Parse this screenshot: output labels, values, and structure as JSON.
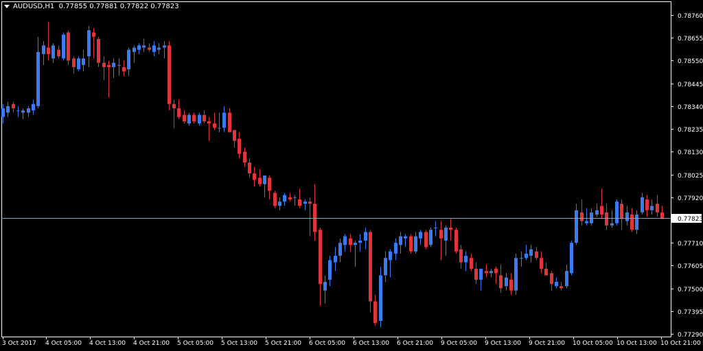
{
  "header": {
    "symbol": "AUDUSD,H1",
    "ohlc": "0.77855 0.77881 0.77822 0.77823"
  },
  "colors": {
    "background": "#000000",
    "axis": "#ffffff",
    "bull": "#3b7bf0",
    "bear": "#e0353a",
    "price_line": "#8fa0c0",
    "price_label_bg": "#ffffff",
    "price_label_text": "#000000"
  },
  "chart_data": {
    "type": "candlestick",
    "title": "AUDUSD,H1",
    "ylim": [
      0.7729,
      0.7876
    ],
    "y_ticks": [
      "0.78760",
      "0.78655",
      "0.78550",
      "0.78445",
      "0.78340",
      "0.78235",
      "0.78130",
      "0.78025",
      "0.77920",
      "0.77823",
      "0.77710",
      "0.77605",
      "0.77500",
      "0.77395",
      "0.77290"
    ],
    "x_ticks": [
      "3 Oct 2017",
      "4 Oct 05:00",
      "4 Oct 13:00",
      "4 Oct 21:00",
      "5 Oct 05:00",
      "5 Oct 13:00",
      "5 Oct 21:00",
      "6 Oct 05:00",
      "6 Oct 13:00",
      "6 Oct 21:00",
      "9 Oct 05:00",
      "9 Oct 13:00",
      "9 Oct 21:00",
      "10 Oct 05:00",
      "10 Oct 13:00",
      "10 Oct 21:00"
    ],
    "current_price": "0.77823",
    "candles": [
      {
        "o": 0.7829,
        "h": 0.7835,
        "l": 0.7826,
        "c": 0.7833
      },
      {
        "o": 0.7831,
        "h": 0.7836,
        "l": 0.7829,
        "c": 0.7834
      },
      {
        "o": 0.7835,
        "h": 0.7836,
        "l": 0.7831,
        "c": 0.7833
      },
      {
        "o": 0.7832,
        "h": 0.7834,
        "l": 0.7829,
        "c": 0.7832
      },
      {
        "o": 0.7831,
        "h": 0.7833,
        "l": 0.7828,
        "c": 0.7832
      },
      {
        "o": 0.7831,
        "h": 0.7834,
        "l": 0.7829,
        "c": 0.7833
      },
      {
        "o": 0.7832,
        "h": 0.7837,
        "l": 0.783,
        "c": 0.7835
      },
      {
        "o": 0.7834,
        "h": 0.7866,
        "l": 0.7833,
        "c": 0.7859
      },
      {
        "o": 0.7858,
        "h": 0.7864,
        "l": 0.7853,
        "c": 0.7862
      },
      {
        "o": 0.7861,
        "h": 0.7873,
        "l": 0.7855,
        "c": 0.7858
      },
      {
        "o": 0.7856,
        "h": 0.7863,
        "l": 0.7854,
        "c": 0.7862
      },
      {
        "o": 0.786,
        "h": 0.7862,
        "l": 0.7856,
        "c": 0.7857
      },
      {
        "o": 0.7856,
        "h": 0.7868,
        "l": 0.7855,
        "c": 0.7867
      },
      {
        "o": 0.7868,
        "h": 0.7869,
        "l": 0.7853,
        "c": 0.7855
      },
      {
        "o": 0.7856,
        "h": 0.7857,
        "l": 0.7849,
        "c": 0.7852
      },
      {
        "o": 0.7851,
        "h": 0.7857,
        "l": 0.785,
        "c": 0.7856
      },
      {
        "o": 0.7853,
        "h": 0.786,
        "l": 0.785,
        "c": 0.7856
      },
      {
        "o": 0.7857,
        "h": 0.7871,
        "l": 0.7852,
        "c": 0.7869
      },
      {
        "o": 0.7868,
        "h": 0.787,
        "l": 0.7856,
        "c": 0.7866
      },
      {
        "o": 0.7865,
        "h": 0.7866,
        "l": 0.7852,
        "c": 0.7854
      },
      {
        "o": 0.7854,
        "h": 0.7857,
        "l": 0.7846,
        "c": 0.7852
      },
      {
        "o": 0.7853,
        "h": 0.7855,
        "l": 0.7838,
        "c": 0.7852
      },
      {
        "o": 0.7852,
        "h": 0.7856,
        "l": 0.7847,
        "c": 0.7854
      },
      {
        "o": 0.7853,
        "h": 0.7856,
        "l": 0.7848,
        "c": 0.7853
      },
      {
        "o": 0.7852,
        "h": 0.7855,
        "l": 0.7848,
        "c": 0.785
      },
      {
        "o": 0.7851,
        "h": 0.7861,
        "l": 0.7848,
        "c": 0.786
      },
      {
        "o": 0.7859,
        "h": 0.7862,
        "l": 0.7854,
        "c": 0.7861
      },
      {
        "o": 0.786,
        "h": 0.7863,
        "l": 0.7858,
        "c": 0.7862
      },
      {
        "o": 0.7861,
        "h": 0.7865,
        "l": 0.7859,
        "c": 0.7862
      },
      {
        "o": 0.7861,
        "h": 0.7863,
        "l": 0.7859,
        "c": 0.786
      },
      {
        "o": 0.7859,
        "h": 0.7864,
        "l": 0.7857,
        "c": 0.7862
      },
      {
        "o": 0.786,
        "h": 0.7863,
        "l": 0.7858,
        "c": 0.7861
      },
      {
        "o": 0.7861,
        "h": 0.7864,
        "l": 0.7856,
        "c": 0.7862
      },
      {
        "o": 0.7862,
        "h": 0.7864,
        "l": 0.7832,
        "c": 0.7835
      },
      {
        "o": 0.7835,
        "h": 0.7837,
        "l": 0.7824,
        "c": 0.7833
      },
      {
        "o": 0.7833,
        "h": 0.7837,
        "l": 0.7828,
        "c": 0.7829
      },
      {
        "o": 0.783,
        "h": 0.7832,
        "l": 0.7826,
        "c": 0.7827
      },
      {
        "o": 0.7826,
        "h": 0.7831,
        "l": 0.7825,
        "c": 0.783
      },
      {
        "o": 0.783,
        "h": 0.7831,
        "l": 0.7826,
        "c": 0.7827
      },
      {
        "o": 0.7826,
        "h": 0.7831,
        "l": 0.7825,
        "c": 0.783
      },
      {
        "o": 0.783,
        "h": 0.7832,
        "l": 0.7826,
        "c": 0.7827
      },
      {
        "o": 0.7827,
        "h": 0.7829,
        "l": 0.7818,
        "c": 0.7826
      },
      {
        "o": 0.7826,
        "h": 0.7831,
        "l": 0.7823,
        "c": 0.7824
      },
      {
        "o": 0.7824,
        "h": 0.7831,
        "l": 0.7822,
        "c": 0.7824
      },
      {
        "o": 0.7824,
        "h": 0.7834,
        "l": 0.7822,
        "c": 0.7831
      },
      {
        "o": 0.7831,
        "h": 0.7833,
        "l": 0.7822,
        "c": 0.7822
      },
      {
        "o": 0.7823,
        "h": 0.7823,
        "l": 0.7815,
        "c": 0.7818
      },
      {
        "o": 0.7819,
        "h": 0.7822,
        "l": 0.781,
        "c": 0.7812
      },
      {
        "o": 0.7813,
        "h": 0.7815,
        "l": 0.7806,
        "c": 0.7808
      },
      {
        "o": 0.7808,
        "h": 0.781,
        "l": 0.7801,
        "c": 0.7803
      },
      {
        "o": 0.7803,
        "h": 0.7806,
        "l": 0.7797,
        "c": 0.78
      },
      {
        "o": 0.7801,
        "h": 0.7805,
        "l": 0.7797,
        "c": 0.7798
      },
      {
        "o": 0.7798,
        "h": 0.7802,
        "l": 0.7792,
        "c": 0.7802
      },
      {
        "o": 0.7801,
        "h": 0.7802,
        "l": 0.7791,
        "c": 0.7795
      },
      {
        "o": 0.7794,
        "h": 0.7795,
        "l": 0.7787,
        "c": 0.7788
      },
      {
        "o": 0.7788,
        "h": 0.7792,
        "l": 0.7786,
        "c": 0.779
      },
      {
        "o": 0.779,
        "h": 0.7794,
        "l": 0.7788,
        "c": 0.7793
      },
      {
        "o": 0.7792,
        "h": 0.7794,
        "l": 0.779,
        "c": 0.7791
      },
      {
        "o": 0.7792,
        "h": 0.7793,
        "l": 0.7788,
        "c": 0.7792
      },
      {
        "o": 0.7791,
        "h": 0.7796,
        "l": 0.7787,
        "c": 0.7788
      },
      {
        "o": 0.7789,
        "h": 0.7791,
        "l": 0.7786,
        "c": 0.779
      },
      {
        "o": 0.779,
        "h": 0.7792,
        "l": 0.7774,
        "c": 0.7789
      },
      {
        "o": 0.7789,
        "h": 0.7798,
        "l": 0.7772,
        "c": 0.7776
      },
      {
        "o": 0.7777,
        "h": 0.7778,
        "l": 0.7742,
        "c": 0.7752
      },
      {
        "o": 0.7749,
        "h": 0.7756,
        "l": 0.7743,
        "c": 0.7753
      },
      {
        "o": 0.7754,
        "h": 0.7765,
        "l": 0.7751,
        "c": 0.7763
      },
      {
        "o": 0.7762,
        "h": 0.7769,
        "l": 0.7758,
        "c": 0.7765
      },
      {
        "o": 0.7765,
        "h": 0.7773,
        "l": 0.7762,
        "c": 0.7771
      },
      {
        "o": 0.777,
        "h": 0.7775,
        "l": 0.7767,
        "c": 0.7774
      },
      {
        "o": 0.7773,
        "h": 0.7775,
        "l": 0.7767,
        "c": 0.777
      },
      {
        "o": 0.777,
        "h": 0.7772,
        "l": 0.776,
        "c": 0.7771
      },
      {
        "o": 0.7771,
        "h": 0.7775,
        "l": 0.7767,
        "c": 0.7772
      },
      {
        "o": 0.7772,
        "h": 0.7778,
        "l": 0.7768,
        "c": 0.7776
      },
      {
        "o": 0.7776,
        "h": 0.7777,
        "l": 0.7739,
        "c": 0.7744
      },
      {
        "o": 0.7744,
        "h": 0.7747,
        "l": 0.7733,
        "c": 0.7734
      },
      {
        "o": 0.7735,
        "h": 0.776,
        "l": 0.7732,
        "c": 0.7756
      },
      {
        "o": 0.7756,
        "h": 0.7767,
        "l": 0.7753,
        "c": 0.7764
      },
      {
        "o": 0.7763,
        "h": 0.7768,
        "l": 0.7755,
        "c": 0.7767
      },
      {
        "o": 0.7766,
        "h": 0.7773,
        "l": 0.7763,
        "c": 0.7771
      },
      {
        "o": 0.777,
        "h": 0.7776,
        "l": 0.7766,
        "c": 0.7774
      },
      {
        "o": 0.7773,
        "h": 0.7775,
        "l": 0.7769,
        "c": 0.7774
      },
      {
        "o": 0.7774,
        "h": 0.7775,
        "l": 0.7766,
        "c": 0.7767
      },
      {
        "o": 0.7767,
        "h": 0.7776,
        "l": 0.7766,
        "c": 0.7774
      },
      {
        "o": 0.7773,
        "h": 0.7777,
        "l": 0.777,
        "c": 0.7776
      },
      {
        "o": 0.7776,
        "h": 0.7777,
        "l": 0.7768,
        "c": 0.7769
      },
      {
        "o": 0.777,
        "h": 0.7778,
        "l": 0.7769,
        "c": 0.7777
      },
      {
        "o": 0.7778,
        "h": 0.7781,
        "l": 0.7774,
        "c": 0.7778
      },
      {
        "o": 0.7777,
        "h": 0.7781,
        "l": 0.7763,
        "c": 0.7773
      },
      {
        "o": 0.7772,
        "h": 0.7779,
        "l": 0.7765,
        "c": 0.7778
      },
      {
        "o": 0.7778,
        "h": 0.7782,
        "l": 0.7772,
        "c": 0.7777
      },
      {
        "o": 0.7777,
        "h": 0.7778,
        "l": 0.7766,
        "c": 0.7767
      },
      {
        "o": 0.7768,
        "h": 0.777,
        "l": 0.7759,
        "c": 0.7762
      },
      {
        "o": 0.7762,
        "h": 0.7767,
        "l": 0.7758,
        "c": 0.7765
      },
      {
        "o": 0.7764,
        "h": 0.7766,
        "l": 0.7758,
        "c": 0.7759
      },
      {
        "o": 0.7759,
        "h": 0.7762,
        "l": 0.7752,
        "c": 0.7754
      },
      {
        "o": 0.7754,
        "h": 0.7757,
        "l": 0.7749,
        "c": 0.7759
      },
      {
        "o": 0.7758,
        "h": 0.7761,
        "l": 0.7755,
        "c": 0.7757
      },
      {
        "o": 0.7757,
        "h": 0.7759,
        "l": 0.7755,
        "c": 0.7758
      },
      {
        "o": 0.7759,
        "h": 0.776,
        "l": 0.7752,
        "c": 0.7757
      },
      {
        "o": 0.7756,
        "h": 0.7761,
        "l": 0.7748,
        "c": 0.775
      },
      {
        "o": 0.7751,
        "h": 0.7757,
        "l": 0.7749,
        "c": 0.7755
      },
      {
        "o": 0.7754,
        "h": 0.7757,
        "l": 0.7747,
        "c": 0.7749
      },
      {
        "o": 0.7749,
        "h": 0.7766,
        "l": 0.7747,
        "c": 0.7764
      },
      {
        "o": 0.7764,
        "h": 0.7767,
        "l": 0.776,
        "c": 0.7764
      },
      {
        "o": 0.7764,
        "h": 0.777,
        "l": 0.7763,
        "c": 0.7766
      },
      {
        "o": 0.7765,
        "h": 0.777,
        "l": 0.7762,
        "c": 0.7768
      },
      {
        "o": 0.7767,
        "h": 0.7769,
        "l": 0.7763,
        "c": 0.7764
      },
      {
        "o": 0.7764,
        "h": 0.7767,
        "l": 0.7757,
        "c": 0.7759
      },
      {
        "o": 0.7759,
        "h": 0.7762,
        "l": 0.7756,
        "c": 0.7756
      },
      {
        "o": 0.7757,
        "h": 0.7758,
        "l": 0.7749,
        "c": 0.7752
      },
      {
        "o": 0.7751,
        "h": 0.7755,
        "l": 0.775,
        "c": 0.7753
      },
      {
        "o": 0.7751,
        "h": 0.7753,
        "l": 0.7749,
        "c": 0.775
      },
      {
        "o": 0.7751,
        "h": 0.7761,
        "l": 0.775,
        "c": 0.7758
      },
      {
        "o": 0.7757,
        "h": 0.7772,
        "l": 0.7756,
        "c": 0.7771
      },
      {
        "o": 0.7771,
        "h": 0.7789,
        "l": 0.777,
        "c": 0.7786
      },
      {
        "o": 0.7785,
        "h": 0.7791,
        "l": 0.7779,
        "c": 0.7781
      },
      {
        "o": 0.778,
        "h": 0.7787,
        "l": 0.7779,
        "c": 0.7781
      },
      {
        "o": 0.778,
        "h": 0.7787,
        "l": 0.7779,
        "c": 0.7785
      },
      {
        "o": 0.7784,
        "h": 0.7789,
        "l": 0.7783,
        "c": 0.7786
      },
      {
        "o": 0.7788,
        "h": 0.7796,
        "l": 0.7782,
        "c": 0.7784
      },
      {
        "o": 0.7785,
        "h": 0.7789,
        "l": 0.7777,
        "c": 0.7779
      },
      {
        "o": 0.7779,
        "h": 0.7786,
        "l": 0.7778,
        "c": 0.778
      },
      {
        "o": 0.778,
        "h": 0.7791,
        "l": 0.7779,
        "c": 0.779
      },
      {
        "o": 0.7789,
        "h": 0.7791,
        "l": 0.7777,
        "c": 0.7782
      },
      {
        "o": 0.7781,
        "h": 0.7788,
        "l": 0.7779,
        "c": 0.7785
      },
      {
        "o": 0.7784,
        "h": 0.7787,
        "l": 0.7776,
        "c": 0.7777
      },
      {
        "o": 0.7777,
        "h": 0.7786,
        "l": 0.7775,
        "c": 0.7784
      },
      {
        "o": 0.7785,
        "h": 0.7794,
        "l": 0.7784,
        "c": 0.7792
      },
      {
        "o": 0.7791,
        "h": 0.7793,
        "l": 0.7783,
        "c": 0.7786
      },
      {
        "o": 0.7786,
        "h": 0.7791,
        "l": 0.7784,
        "c": 0.7788
      },
      {
        "o": 0.7789,
        "h": 0.7793,
        "l": 0.7783,
        "c": 0.7785
      },
      {
        "o": 0.7785,
        "h": 0.7788,
        "l": 0.7782,
        "c": 0.7782
      }
    ]
  }
}
